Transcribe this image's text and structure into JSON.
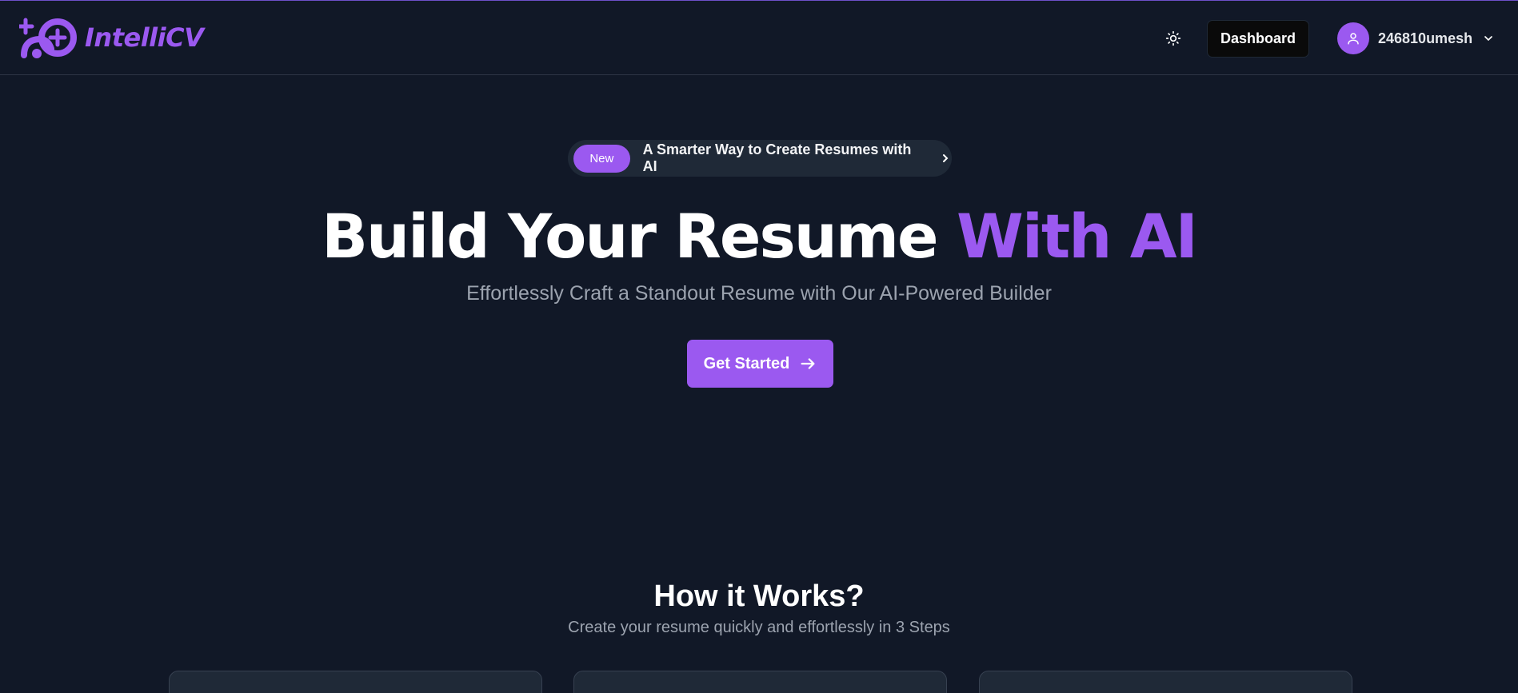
{
  "header": {
    "logo_text": "IntelliCV",
    "theme_icon": "sun-icon",
    "dashboard_label": "Dashboard",
    "username": "246810umesh",
    "avatar_icon": "user-icon",
    "menu_icon": "chevron-down-icon"
  },
  "announcement": {
    "badge": "New",
    "text": "A Smarter Way to Create Resumes with AI",
    "icon": "chevron-right-icon"
  },
  "hero": {
    "title_main": "Build Your Resume",
    "title_accent": "With AI",
    "subtitle": "Effortlessly Craft a Standout Resume with Our AI-Powered Builder",
    "cta_label": "Get Started",
    "cta_icon": "arrow-right-icon"
  },
  "how_it_works": {
    "title": "How it Works?",
    "subtitle": "Create your resume quickly and effortlessly in 3 Steps"
  },
  "colors": {
    "background": "#111827",
    "accent": "#9b59f0",
    "card": "#1f2937",
    "muted_text": "#9ca3af"
  }
}
